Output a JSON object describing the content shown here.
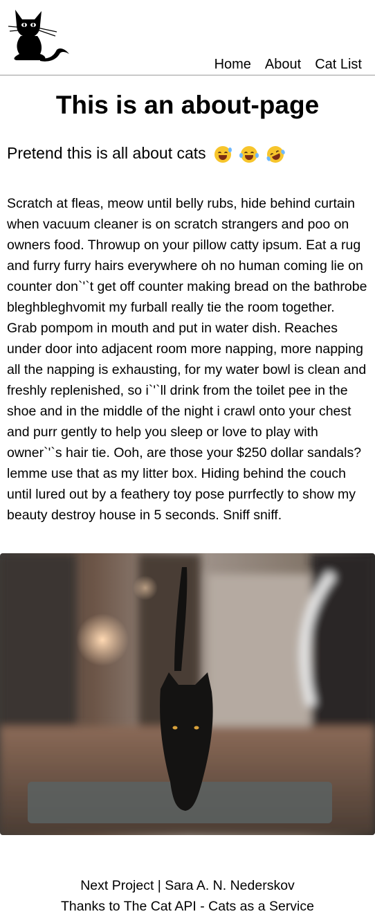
{
  "nav": {
    "home": "Home",
    "about": "About",
    "cat_list": "Cat List"
  },
  "main": {
    "title": "This is an about-page",
    "subtitle": "Pretend this is all about cats",
    "emojis": [
      "sweat-smile-emoji",
      "tears-of-joy-emoji",
      "rofl-emoji"
    ],
    "body": "Scratch at fleas, meow until belly rubs, hide behind curtain when vacuum cleaner is on scratch strangers and poo on owners food. Throwup on your pillow catty ipsum. Eat a rug and furry furry hairs everywhere oh no human coming lie on counter don`'`t get off counter making bread on the bathrobe bleghbleghvomit my furball really tie the room together. Grab pompom in mouth and put in water dish. Reaches under door into adjacent room more napping, more napping all the napping is exhausting, for my water bowl is clean and freshly replenished, so i`'`ll drink from the toilet pee in the shoe and in the middle of the night i crawl onto your chest and purr gently to help you sleep or love to play with owner`'`s hair tie. Ooh, are those your $250 dollar sandals? lemme use that as my litter box. Hiding behind the couch until lured out by a feathery toy pose purrfectly to show my beauty destroy house in 5 seconds. Sniff sniff."
  },
  "footer": {
    "line1": "Next Project | Sara A. N. Nederskov",
    "line2": "Thanks to The Cat API - Cats as a Service"
  },
  "colors": {
    "text": "#000000",
    "background": "#ffffff",
    "divider": "#9a9a9a",
    "emoji": "#f7c52c"
  }
}
